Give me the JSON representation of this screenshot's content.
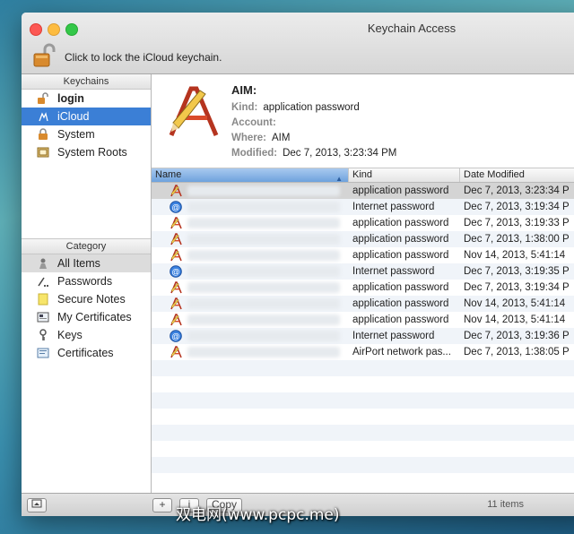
{
  "window": {
    "title": "Keychain Access"
  },
  "lock_bar": {
    "text": "Click to lock the iCloud keychain."
  },
  "keychains": {
    "header": "Keychains",
    "items": [
      {
        "label": "login",
        "icon": "unlocked-lock-icon"
      },
      {
        "label": "iCloud",
        "icon": "icloud-keychain-icon"
      },
      {
        "label": "System",
        "icon": "lock-icon"
      },
      {
        "label": "System Roots",
        "icon": "cabinet-icon"
      }
    ]
  },
  "category": {
    "header": "Category",
    "items": [
      {
        "label": "All Items",
        "icon": "all-items-icon"
      },
      {
        "label": "Passwords",
        "icon": "password-dots-icon"
      },
      {
        "label": "Secure Notes",
        "icon": "note-icon"
      },
      {
        "label": "My Certificates",
        "icon": "certificate-icon"
      },
      {
        "label": "Keys",
        "icon": "key-icon"
      },
      {
        "label": "Certificates",
        "icon": "certificate-icon"
      }
    ]
  },
  "detail": {
    "title": "AIM:",
    "kind_label": "Kind:",
    "kind_value": "application password",
    "account_label": "Account:",
    "account_value": "",
    "where_label": "Where:",
    "where_value": "AIM",
    "modified_label": "Modified:",
    "modified_value": "Dec 7, 2013, 3:23:34 PM"
  },
  "table": {
    "columns": [
      "Name",
      "Kind",
      "Date Modified"
    ],
    "rows": [
      {
        "icon": "app-password-icon",
        "kind": "application password",
        "date": "Dec 7, 2013, 3:23:34 P"
      },
      {
        "icon": "internet-password-icon",
        "kind": "Internet password",
        "date": "Dec 7, 2013, 3:19:34 P"
      },
      {
        "icon": "app-password-icon",
        "kind": "application password",
        "date": "Dec 7, 2013, 3:19:33 P"
      },
      {
        "icon": "app-password-icon",
        "kind": "application password",
        "date": "Dec 7, 2013, 1:38:00 P"
      },
      {
        "icon": "app-password-icon",
        "kind": "application password",
        "date": "Nov 14, 2013, 5:41:14"
      },
      {
        "icon": "internet-password-icon",
        "kind": "Internet password",
        "date": "Dec 7, 2013, 3:19:35 P"
      },
      {
        "icon": "app-password-icon",
        "kind": "application password",
        "date": "Dec 7, 2013, 3:19:34 P"
      },
      {
        "icon": "app-password-icon",
        "kind": "application password",
        "date": "Nov 14, 2013, 5:41:14"
      },
      {
        "icon": "app-password-icon",
        "kind": "application password",
        "date": "Nov 14, 2013, 5:41:14"
      },
      {
        "icon": "internet-password-icon",
        "kind": "Internet password",
        "date": "Dec 7, 2013, 3:19:36 P"
      },
      {
        "icon": "app-password-icon",
        "kind": "AirPort network pas...",
        "date": "Dec 7, 2013, 1:38:05 P"
      }
    ]
  },
  "footer": {
    "count": "11 items",
    "add": "+",
    "info": "i",
    "copy": "Copy"
  },
  "watermark": "双电网(www.pcpc.me)"
}
